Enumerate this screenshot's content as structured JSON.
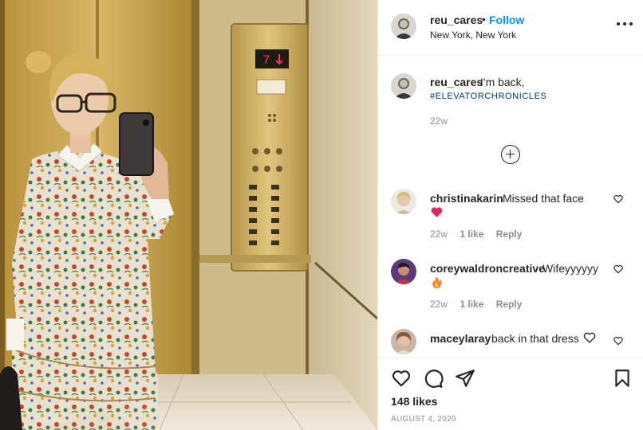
{
  "post": {
    "username": "reu_cares",
    "follow_label": "Follow",
    "separator": "•",
    "location": "New York, New York",
    "caption_text": "I'm back,",
    "hashtag": "#ELEVATORCHRONICLES",
    "caption_time": "22w",
    "likes": "148 likes",
    "date": "AUGUST 4, 2020"
  },
  "photo": {
    "elevator_display": "7",
    "subject": "woman taking mirror selfie in elevator"
  },
  "comments": [
    {
      "username": "christinakarin",
      "text": "Missed that face",
      "emoji": "red-heart-emoji",
      "time": "22w",
      "likes": "1 like",
      "reply": "Reply"
    },
    {
      "username": "coreywaldroncreative",
      "text": "Wifeyyyyyy",
      "emoji": "fire-emoji",
      "time": "22w",
      "likes": "1 like",
      "reply": "Reply"
    },
    {
      "username": "maceylaray",
      "text": "back in that dress",
      "emoji": "white-heart-emoji"
    }
  ],
  "icons": {
    "more": "more-options-icon",
    "add": "load-more-comments-icon",
    "like": "heart-icon",
    "comment": "comment-icon",
    "share": "share-icon",
    "save": "bookmark-icon"
  },
  "colors": {
    "follow": "#0095f6",
    "hashtag": "#00376b",
    "muted": "#8e8e8e",
    "text": "#262626"
  }
}
